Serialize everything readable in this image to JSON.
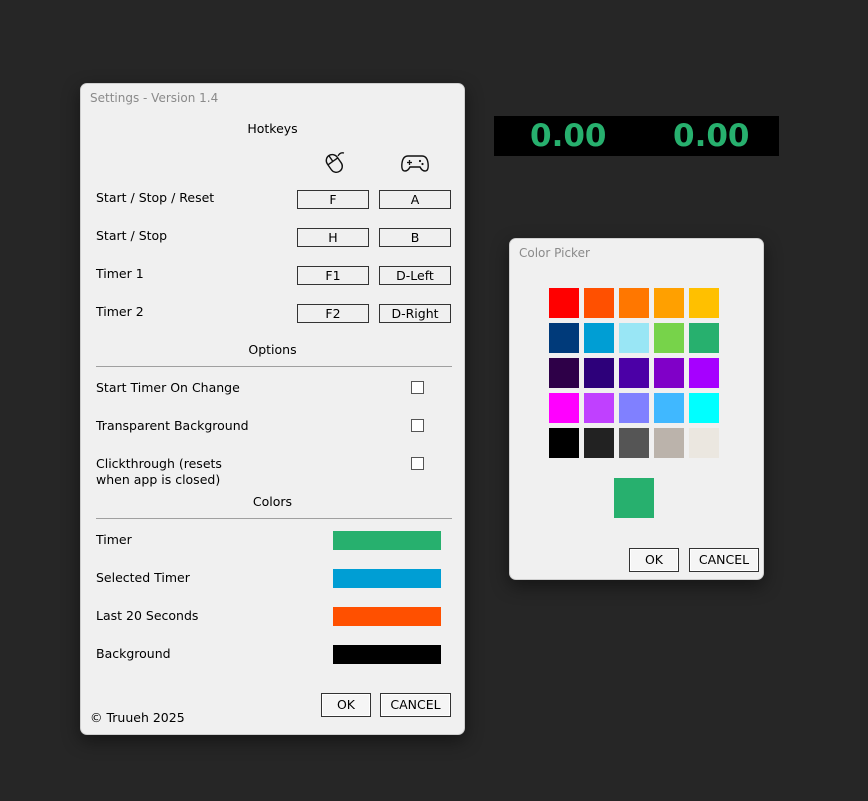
{
  "settings": {
    "title": "Settings - Version 1.4",
    "hotkeys_title": "Hotkeys",
    "icons": {
      "mouse": "mouse-icon",
      "gamepad": "gamepad-icon"
    },
    "hotkeys": [
      {
        "label": "Start / Stop / Reset",
        "key": "F",
        "pad": "A"
      },
      {
        "label": "Start / Stop",
        "key": "H",
        "pad": "B"
      },
      {
        "label": "Timer 1",
        "key": "F1",
        "pad": "D-Left"
      },
      {
        "label": "Timer 2",
        "key": "F2",
        "pad": "D-Right"
      }
    ],
    "options_title": "Options",
    "options": [
      {
        "label": "Start Timer On Change",
        "checked": false
      },
      {
        "label": "Transparent Background",
        "checked": false
      },
      {
        "label": "Clickthrough (resets",
        "label2": "when app is closed)",
        "checked": false
      }
    ],
    "colors_title": "Colors",
    "colors": [
      {
        "label": "Timer",
        "color": "#27b06e"
      },
      {
        "label": "Selected Timer",
        "color": "#009ed4"
      },
      {
        "label": "Last 20 Seconds",
        "color": "#ff5000"
      },
      {
        "label": "Background",
        "color": "#000000"
      }
    ],
    "ok": "OK",
    "cancel": "CANCEL",
    "footer": "© Truueh 2025"
  },
  "timers": {
    "timer1": "0.00",
    "timer2": "0.00",
    "color": "#27b06e"
  },
  "picker": {
    "title": "Color Picker",
    "palette": [
      [
        "#ff0000",
        "#ff5000",
        "#ff7700",
        "#ffa000",
        "#ffc000"
      ],
      [
        "#003a7a",
        "#009ed4",
        "#99e6f5",
        "#77d34a",
        "#27b06e"
      ],
      [
        "#2e0048",
        "#2d007a",
        "#4b00a6",
        "#8000c8",
        "#a600ff"
      ],
      [
        "#ff00ff",
        "#c040ff",
        "#8080ff",
        "#40b8ff",
        "#00ffff"
      ],
      [
        "#000000",
        "#222222",
        "#555555",
        "#bbb3ab",
        "#ebe7e0"
      ]
    ],
    "selected": "#27b06e",
    "ok": "OK",
    "cancel": "CANCEL"
  }
}
